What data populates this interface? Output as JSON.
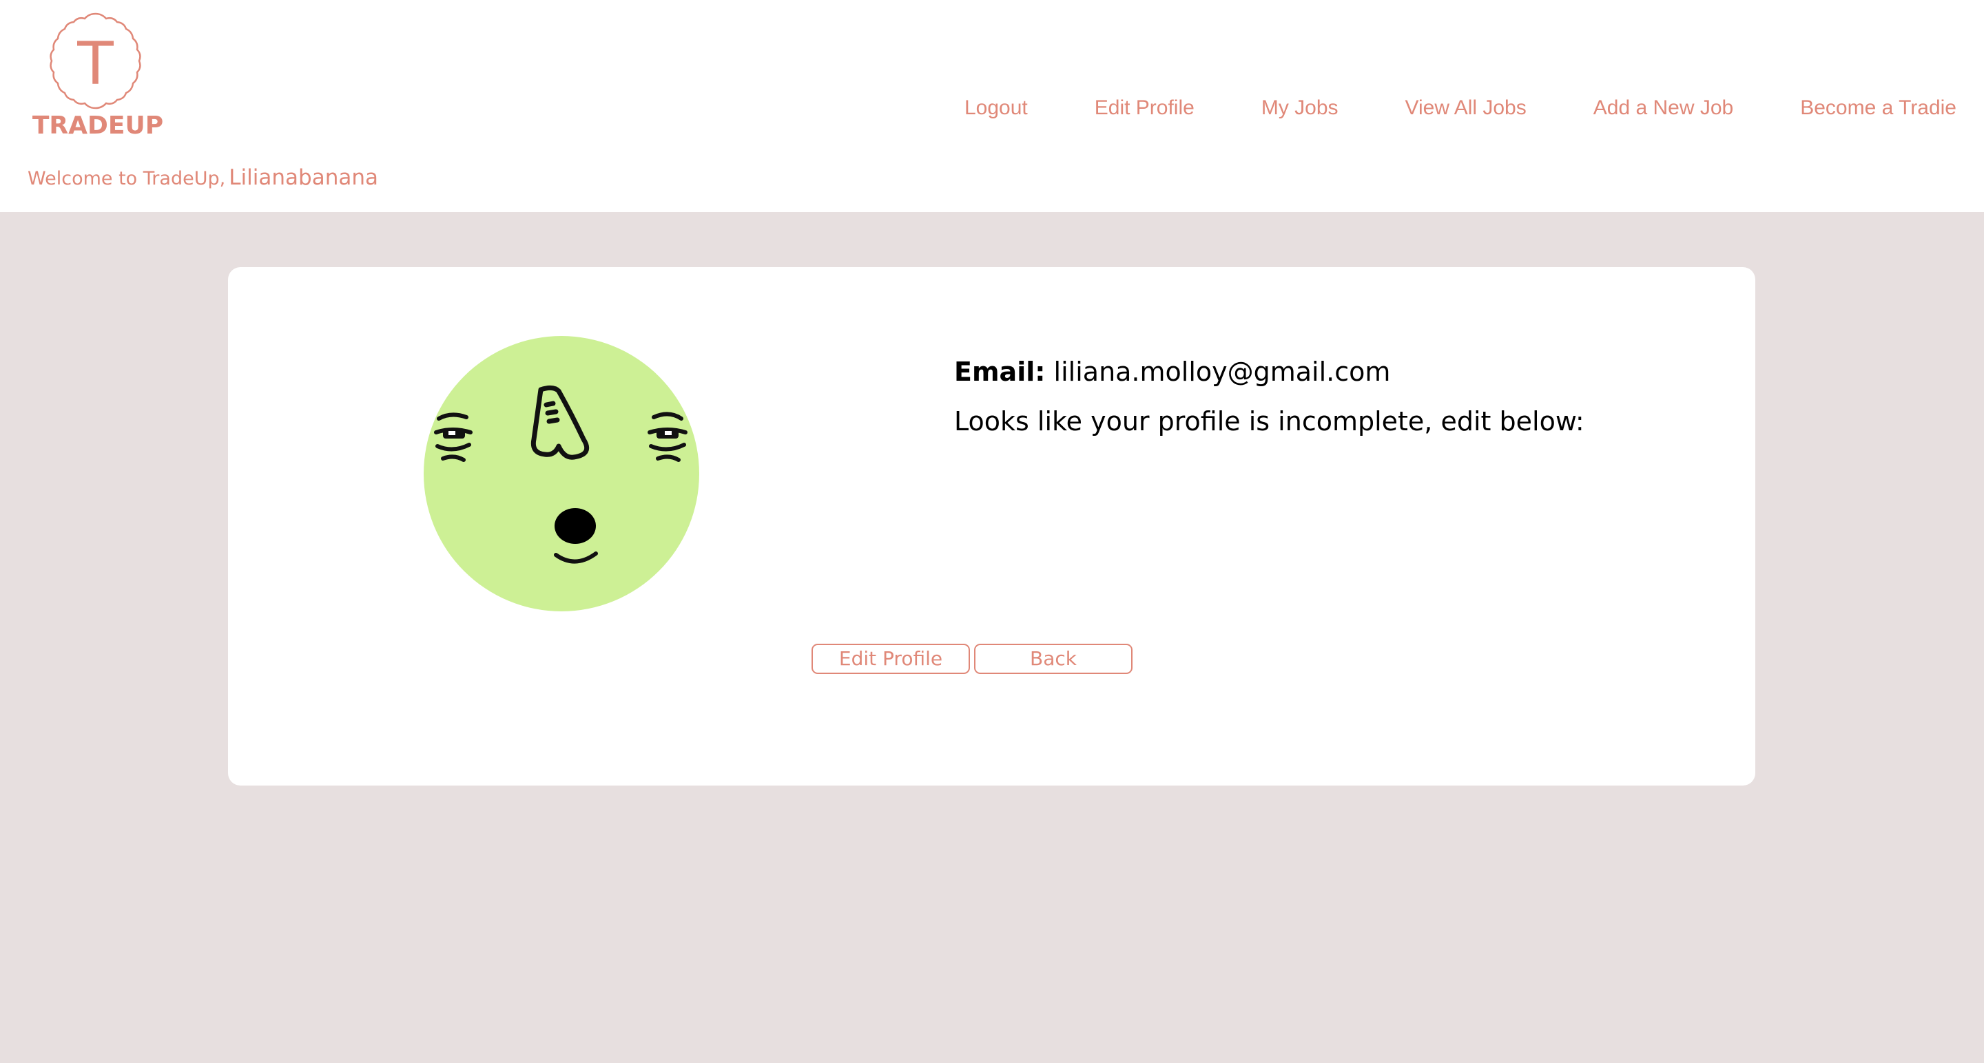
{
  "brand": {
    "logo_letter": "T",
    "name": "TRADEUP",
    "color": "#e08878"
  },
  "welcome": {
    "text": "Welcome to TradeUp,",
    "username": "Lilianabanana"
  },
  "nav": {
    "items": [
      {
        "label": "Logout"
      },
      {
        "label": "Edit Profile"
      },
      {
        "label": "My Jobs"
      },
      {
        "label": "View All Jobs"
      },
      {
        "label": "Add a New Job"
      },
      {
        "label": "Become a Tradie"
      }
    ]
  },
  "profile": {
    "email_label": "Email:",
    "email_value": "liliana.molloy@gmail.com",
    "message": "Looks like your profile is incomplete, edit below:",
    "avatar_icon": "cartoon-face-avatar",
    "avatar_color": "#cdf095"
  },
  "actions": {
    "edit_label": "Edit Profile",
    "back_label": "Back"
  },
  "colors": {
    "background": "#e7dfdf",
    "card": "#ffffff",
    "accent": "#e08878"
  }
}
